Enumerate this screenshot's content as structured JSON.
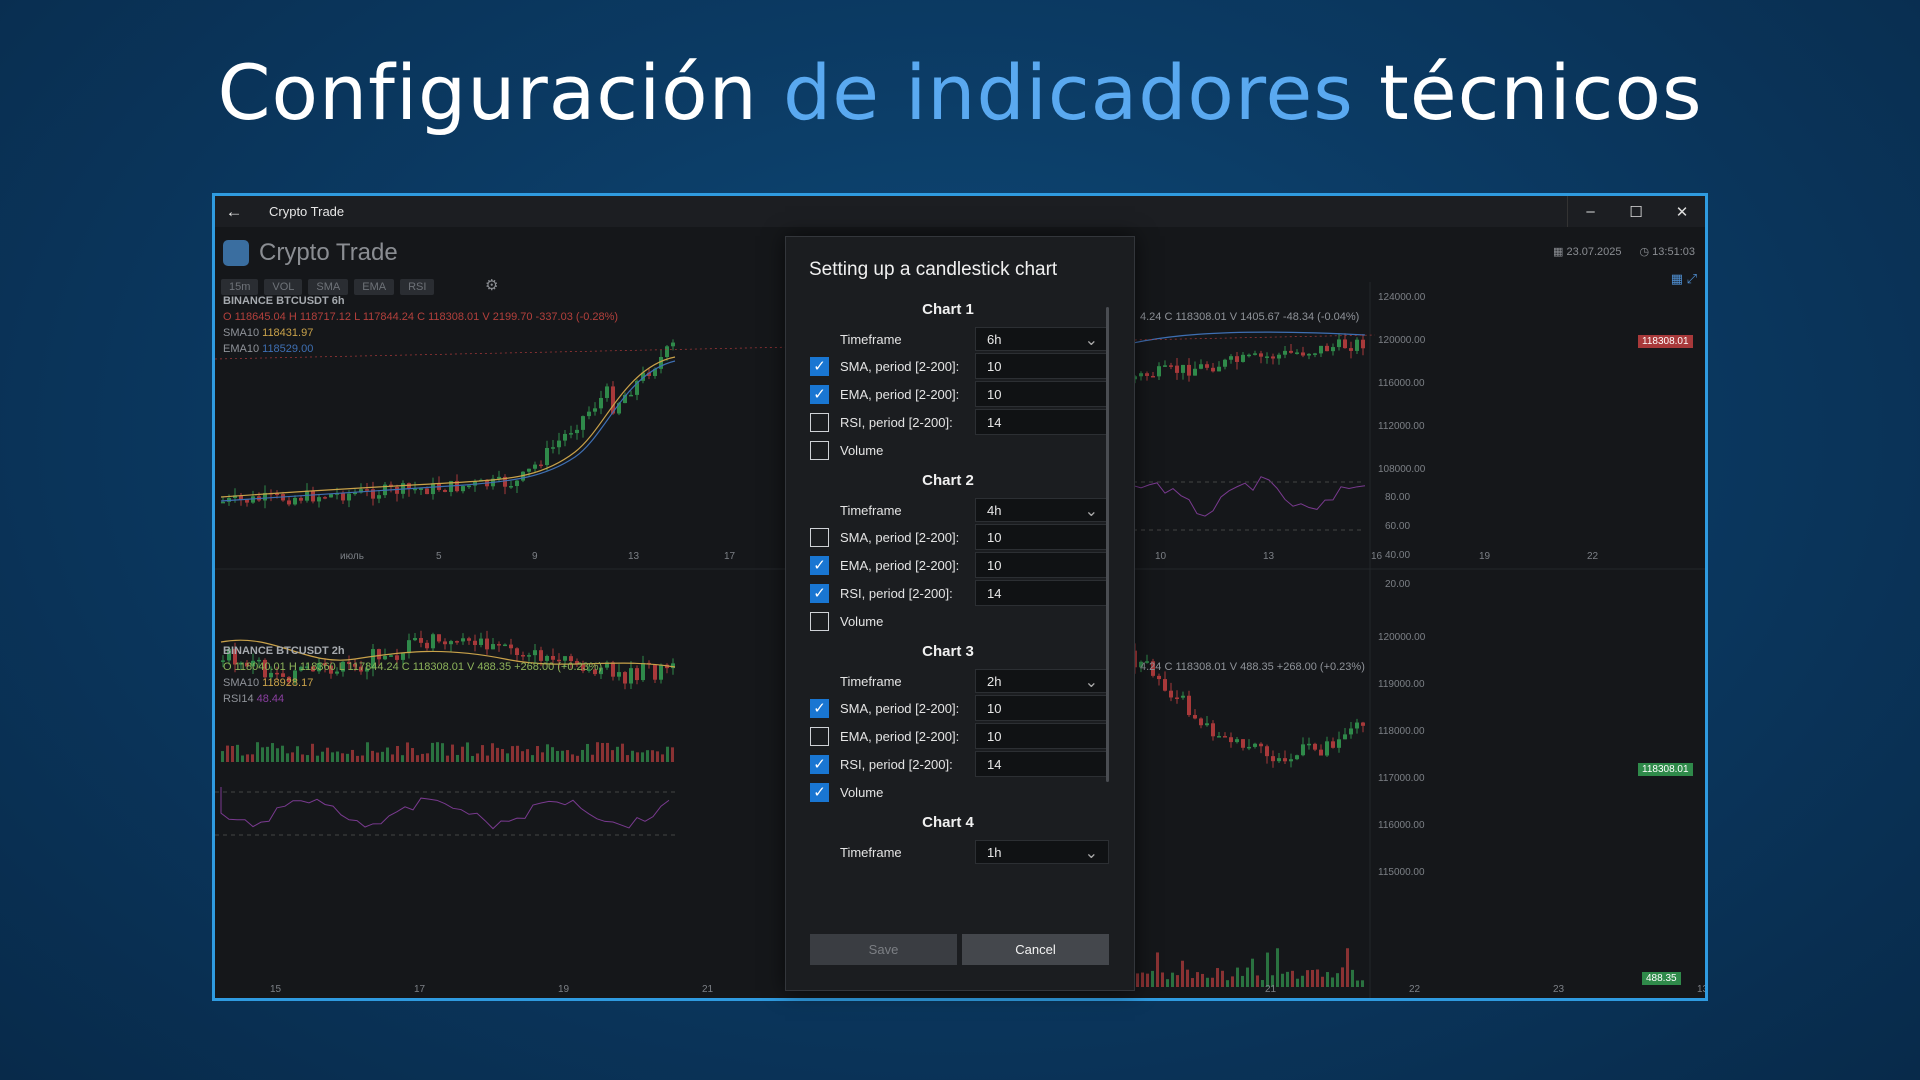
{
  "headline": {
    "part1": "Configuración",
    "part2": "de indicadores",
    "part3": "técnicos"
  },
  "window": {
    "title": "Crypto Trade",
    "app_name": "Crypto Trade",
    "date": "23.07.2025",
    "time": "13:51:03",
    "toolbar_chips": [
      "15m",
      "VOL",
      "SMA",
      "EMA",
      "RSI"
    ]
  },
  "chart_top": {
    "symbol": "BINANCE BTCUSDT 6h",
    "ohlc": "O 118645.04 H 118717.12 L 117844.24 C 118308.01 V 2199.70 -337.03 (-0.28%)",
    "ohlc_right": "4.24 C 118308.01 V 1405.67 -48.34 (-0.04%)",
    "sma": "SMA10",
    "sma_value": "118431.97",
    "ema": "EMA10",
    "ema_value": "118529.00",
    "price_axis": [
      "124000.00",
      "120000.00",
      "116000.00",
      "112000.00",
      "108000.00"
    ],
    "rsi_axis": [
      "80.00",
      "60.00",
      "40.00",
      "20.00"
    ],
    "last_price": "118308.01",
    "x_labels_left": [
      "июль",
      "5",
      "9",
      "13",
      "17"
    ],
    "x_labels_right": [
      "10",
      "13",
      "16",
      "19",
      "22"
    ]
  },
  "chart_bottom": {
    "symbol": "BINANCE BTCUSDT 2h",
    "ohlc": "O 118040.01 H 118360 L 117844.24 C 118308.01 V 488.35 +268.00 (+0.23%)",
    "ohlc_right": "4.24 C 118308.01 V 488.35 +268.00 (+0.23%)",
    "sma": "SMA10",
    "sma_value": "118928.17",
    "rsi": "RSI14",
    "rsi_value": "48.44",
    "price_axis": [
      "120000.00",
      "119000.00",
      "118000.00",
      "117000.00",
      "116000.00",
      "115000.00"
    ],
    "last_price": "118308.01",
    "volume_tag": "488.35",
    "x_labels_left": [
      "15",
      "17",
      "19",
      "21"
    ],
    "x_labels_right": [
      "21",
      "22",
      "23",
      "13:"
    ]
  },
  "dialog": {
    "title": "Setting up a candlestick chart",
    "labels": {
      "timeframe": "Timeframe",
      "sma": "SMA, period [2-200]:",
      "ema": "EMA, period [2-200]:",
      "rsi": "RSI, period [2-200]:",
      "volume": "Volume"
    },
    "charts": [
      {
        "title": "Chart 1",
        "timeframe": "6h",
        "sma": {
          "on": true,
          "value": "10"
        },
        "ema": {
          "on": true,
          "value": "10"
        },
        "rsi": {
          "on": false,
          "value": "14"
        },
        "volume": false
      },
      {
        "title": "Chart 2",
        "timeframe": "4h",
        "sma": {
          "on": false,
          "value": "10"
        },
        "ema": {
          "on": true,
          "value": "10"
        },
        "rsi": {
          "on": true,
          "value": "14"
        },
        "volume": false
      },
      {
        "title": "Chart 3",
        "timeframe": "2h",
        "sma": {
          "on": true,
          "value": "10"
        },
        "ema": {
          "on": false,
          "value": "10"
        },
        "rsi": {
          "on": true,
          "value": "14"
        },
        "volume": true
      },
      {
        "title": "Chart 4",
        "timeframe": "1h"
      }
    ],
    "save_label": "Save",
    "cancel_label": "Cancel"
  },
  "colors": {
    "accent": "#1976d2",
    "bull": "#2f8a4a",
    "bear": "#a8393a",
    "sma": "#c9a24a",
    "ema": "#3e6fb3",
    "rsi": "#7a3a90"
  }
}
